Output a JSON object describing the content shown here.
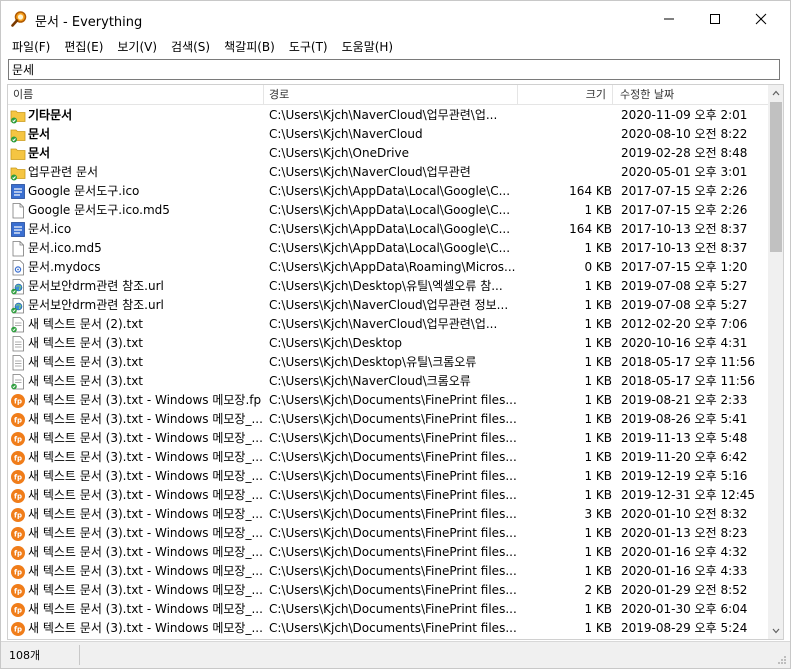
{
  "window": {
    "title": "문서 - Everything"
  },
  "menu": [
    "파일(F)",
    "편집(E)",
    "보기(V)",
    "검색(S)",
    "책갈피(B)",
    "도구(T)",
    "도움말(H)"
  ],
  "search": {
    "value": "문세"
  },
  "columns": {
    "name": "이름",
    "path": "경로",
    "size": "크기",
    "date": "수정한 날짜"
  },
  "rows": [
    {
      "icon": "folder-cloud-icon",
      "name": "기타문서",
      "bold": true,
      "path": "C:\\Users\\Kjch\\NaverCloud\\업무관련\\업...",
      "size": "",
      "date": "2020-11-09 오후 2:01"
    },
    {
      "icon": "folder-cloud-icon",
      "name": "문서",
      "bold": true,
      "path": "C:\\Users\\Kjch\\NaverCloud",
      "size": "",
      "date": "2020-08-10 오전 8:22"
    },
    {
      "icon": "folder-icon",
      "name": "문서",
      "bold": true,
      "path": "C:\\Users\\Kjch\\OneDrive",
      "size": "",
      "date": "2019-02-28 오전 8:48"
    },
    {
      "icon": "folder-cloud-icon",
      "name": "업무관련 문서",
      "bold": false,
      "path": "C:\\Users\\Kjch\\NaverCloud\\업무관련",
      "size": "",
      "date": "2020-05-01 오후 3:01"
    },
    {
      "icon": "ico-file-icon",
      "name": "Google 문서도구.ico",
      "bold": false,
      "path": "C:\\Users\\Kjch\\AppData\\Local\\Google\\C...",
      "size": "164 KB",
      "date": "2017-07-15 오후 2:26"
    },
    {
      "icon": "blank-file-icon",
      "name": "Google 문서도구.ico.md5",
      "bold": false,
      "path": "C:\\Users\\Kjch\\AppData\\Local\\Google\\C...",
      "size": "1 KB",
      "date": "2017-07-15 오후 2:26"
    },
    {
      "icon": "ico-file-icon",
      "name": "문서.ico",
      "bold": false,
      "path": "C:\\Users\\Kjch\\AppData\\Local\\Google\\C...",
      "size": "164 KB",
      "date": "2017-10-13 오전 8:37"
    },
    {
      "icon": "blank-file-icon",
      "name": "문서.ico.md5",
      "bold": false,
      "path": "C:\\Users\\Kjch\\AppData\\Local\\Google\\C...",
      "size": "1 KB",
      "date": "2017-10-13 오전 8:37"
    },
    {
      "icon": "config-file-icon",
      "name": "문서.mydocs",
      "bold": false,
      "path": "C:\\Users\\Kjch\\AppData\\Roaming\\Micros...",
      "size": "0 KB",
      "date": "2017-07-15 오후 1:20"
    },
    {
      "icon": "url-file-icon",
      "name": "문서보안drm관련 참조.url",
      "bold": false,
      "path": "C:\\Users\\Kjch\\Desktop\\유틸\\엑셀오류 참...",
      "size": "1 KB",
      "date": "2019-07-08 오후 5:27"
    },
    {
      "icon": "url-file-icon",
      "name": "문서보안drm관련 참조.url",
      "bold": false,
      "path": "C:\\Users\\Kjch\\NaverCloud\\업무관련 정보...",
      "size": "1 KB",
      "date": "2019-07-08 오후 5:27"
    },
    {
      "icon": "text-cloud-icon",
      "name": "새 텍스트 문서 (2).txt",
      "bold": false,
      "path": "C:\\Users\\Kjch\\NaverCloud\\업무관련\\업...",
      "size": "1 KB",
      "date": "2012-02-20 오후 7:06"
    },
    {
      "icon": "text-file-icon",
      "name": "새 텍스트 문서 (3).txt",
      "bold": false,
      "path": "C:\\Users\\Kjch\\Desktop",
      "size": "1 KB",
      "date": "2020-10-16 오후 4:31"
    },
    {
      "icon": "text-file-icon",
      "name": "새 텍스트 문서 (3).txt",
      "bold": false,
      "path": "C:\\Users\\Kjch\\Desktop\\유틸\\크롬오류",
      "size": "1 KB",
      "date": "2018-05-17 오후 11:56"
    },
    {
      "icon": "text-cloud-icon",
      "name": "새 텍스트 문서 (3).txt",
      "bold": false,
      "path": "C:\\Users\\Kjch\\NaverCloud\\크롬오류",
      "size": "1 KB",
      "date": "2018-05-17 오후 11:56"
    },
    {
      "icon": "fp-file-icon",
      "name": "새 텍스트 문서 (3).txt - Windows 메모장.fp",
      "bold": false,
      "path": "C:\\Users\\Kjch\\Documents\\FinePrint files...",
      "size": "1 KB",
      "date": "2019-08-21 오후 2:33"
    },
    {
      "icon": "fp-file-icon",
      "name": "새 텍스트 문서 (3).txt - Windows 메모장_...",
      "bold": false,
      "path": "C:\\Users\\Kjch\\Documents\\FinePrint files...",
      "size": "1 KB",
      "date": "2019-08-26 오후 5:41"
    },
    {
      "icon": "fp-file-icon",
      "name": "새 텍스트 문서 (3).txt - Windows 메모장_...",
      "bold": false,
      "path": "C:\\Users\\Kjch\\Documents\\FinePrint files...",
      "size": "1 KB",
      "date": "2019-11-13 오후 5:48"
    },
    {
      "icon": "fp-file-icon",
      "name": "새 텍스트 문서 (3).txt - Windows 메모장_...",
      "bold": false,
      "path": "C:\\Users\\Kjch\\Documents\\FinePrint files...",
      "size": "1 KB",
      "date": "2019-11-20 오후 6:42"
    },
    {
      "icon": "fp-file-icon",
      "name": "새 텍스트 문서 (3).txt - Windows 메모장_...",
      "bold": false,
      "path": "C:\\Users\\Kjch\\Documents\\FinePrint files...",
      "size": "1 KB",
      "date": "2019-12-19 오후 5:16"
    },
    {
      "icon": "fp-file-icon",
      "name": "새 텍스트 문서 (3).txt - Windows 메모장_...",
      "bold": false,
      "path": "C:\\Users\\Kjch\\Documents\\FinePrint files...",
      "size": "1 KB",
      "date": "2019-12-31 오후 12:45"
    },
    {
      "icon": "fp-file-icon",
      "name": "새 텍스트 문서 (3).txt - Windows 메모장_...",
      "bold": false,
      "path": "C:\\Users\\Kjch\\Documents\\FinePrint files...",
      "size": "3 KB",
      "date": "2020-01-10 오전 8:32"
    },
    {
      "icon": "fp-file-icon",
      "name": "새 텍스트 문서 (3).txt - Windows 메모장_...",
      "bold": false,
      "path": "C:\\Users\\Kjch\\Documents\\FinePrint files...",
      "size": "1 KB",
      "date": "2020-01-13 오전 8:23"
    },
    {
      "icon": "fp-file-icon",
      "name": "새 텍스트 문서 (3).txt - Windows 메모장_...",
      "bold": false,
      "path": "C:\\Users\\Kjch\\Documents\\FinePrint files...",
      "size": "1 KB",
      "date": "2020-01-16 오후 4:32"
    },
    {
      "icon": "fp-file-icon",
      "name": "새 텍스트 문서 (3).txt - Windows 메모장_...",
      "bold": false,
      "path": "C:\\Users\\Kjch\\Documents\\FinePrint files...",
      "size": "1 KB",
      "date": "2020-01-16 오후 4:33"
    },
    {
      "icon": "fp-file-icon",
      "name": "새 텍스트 문서 (3).txt - Windows 메모장_...",
      "bold": false,
      "path": "C:\\Users\\Kjch\\Documents\\FinePrint files...",
      "size": "2 KB",
      "date": "2020-01-29 오전 8:52"
    },
    {
      "icon": "fp-file-icon",
      "name": "새 텍스트 문서 (3).txt - Windows 메모장_...",
      "bold": false,
      "path": "C:\\Users\\Kjch\\Documents\\FinePrint files...",
      "size": "1 KB",
      "date": "2020-01-30 오후 6:04"
    },
    {
      "icon": "fp-file-icon",
      "name": "새 텍스트 문서 (3).txt - Windows 메모장_...",
      "bold": false,
      "path": "C:\\Users\\Kjch\\Documents\\FinePrint files...",
      "size": "1 KB",
      "date": "2019-08-29 오후 5:24"
    }
  ],
  "status": {
    "count": "108개"
  },
  "colors": {
    "folder": "#f5c542",
    "cloud_check": "#2e9e3e",
    "fp": "#f07d1a",
    "ico_blue": "#3a6fd1"
  }
}
